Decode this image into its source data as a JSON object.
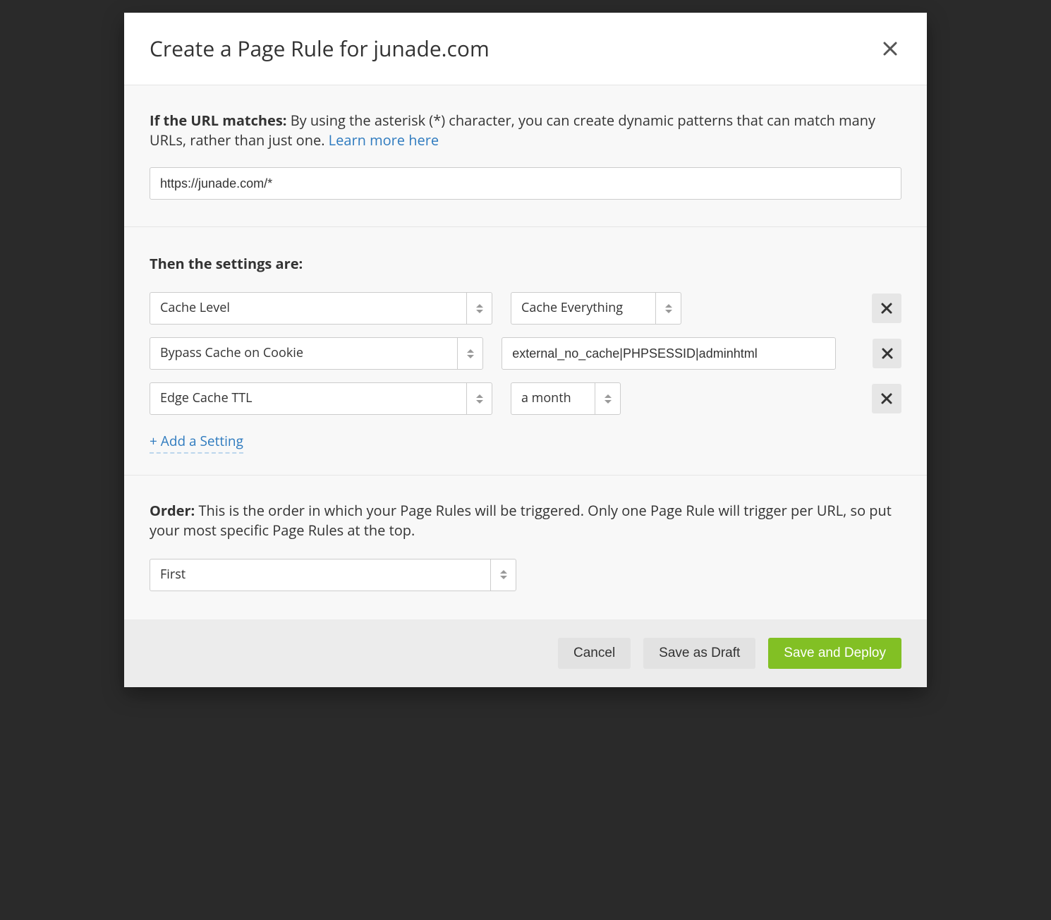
{
  "modal": {
    "title": "Create a Page Rule for junade.com"
  },
  "url_match": {
    "label": "If the URL matches:",
    "help": "By using the asterisk (*) character, you can create dynamic patterns that can match many URLs, rather than just one.",
    "learn_more": "Learn more here",
    "input_value": "https://junade.com/*"
  },
  "settings": {
    "heading": "Then the settings are:",
    "rows": [
      {
        "setting": "Cache Level",
        "value_type": "select",
        "value": "Cache Everything"
      },
      {
        "setting": "Bypass Cache on Cookie",
        "value_type": "text",
        "value": "external_no_cache|PHPSESSID|adminhtml"
      },
      {
        "setting": "Edge Cache TTL",
        "value_type": "select_small",
        "value": "a month"
      }
    ],
    "add_label": "+ Add a Setting"
  },
  "order": {
    "label": "Order:",
    "help": "This is the order in which your Page Rules will be triggered. Only one Page Rule will trigger per URL, so put your most specific Page Rules at the top.",
    "value": "First"
  },
  "footer": {
    "cancel": "Cancel",
    "draft": "Save as Draft",
    "deploy": "Save and Deploy"
  },
  "icons": {
    "close": "close-icon",
    "remove": "remove-icon",
    "stepper": "stepper-icon"
  }
}
